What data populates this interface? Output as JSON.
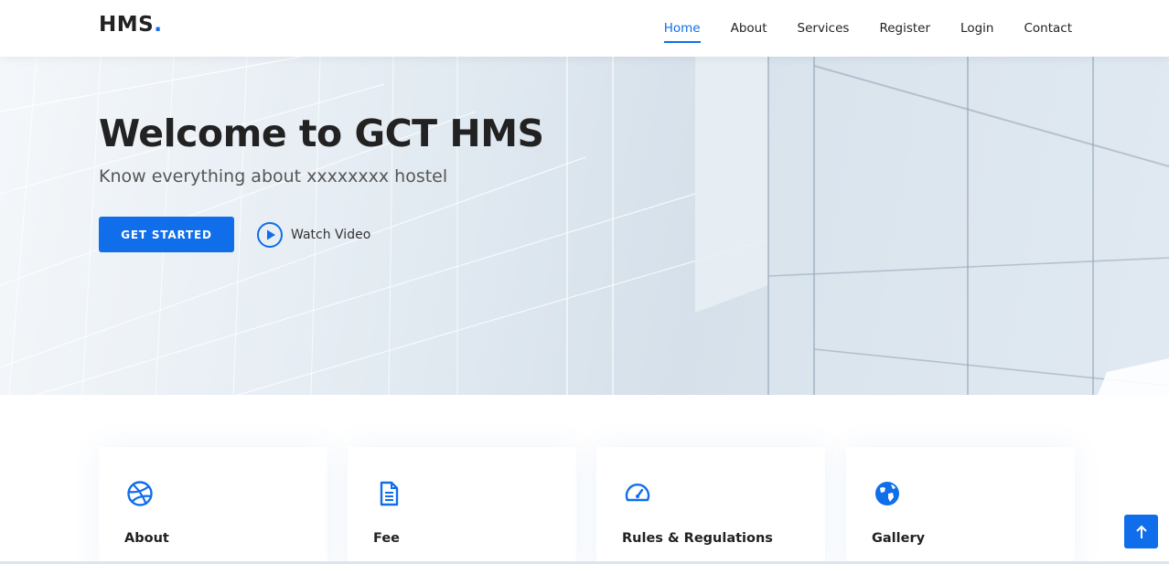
{
  "brand": {
    "name": "HMS",
    "dot": ".",
    "accent": "#106eea"
  },
  "nav": {
    "items": [
      {
        "label": "Home",
        "active": true
      },
      {
        "label": "About"
      },
      {
        "label": "Services"
      },
      {
        "label": "Register"
      },
      {
        "label": "Login"
      },
      {
        "label": "Contact"
      }
    ]
  },
  "hero": {
    "title": "Welcome to GCT HMS",
    "subtitle": "Know everything about xxxxxxxx hostel",
    "cta_label": "GET STARTED",
    "watch_label": "Watch Video",
    "watch_icon": "play-circle-icon"
  },
  "cards": [
    {
      "label": "About",
      "icon": "dribbble-icon"
    },
    {
      "label": "Fee",
      "icon": "document-icon"
    },
    {
      "label": "Rules & Regulations",
      "icon": "speedometer-icon"
    },
    {
      "label": "Gallery",
      "icon": "globe-icon"
    }
  ],
  "back_to_top": {
    "icon": "arrow-up-icon"
  }
}
